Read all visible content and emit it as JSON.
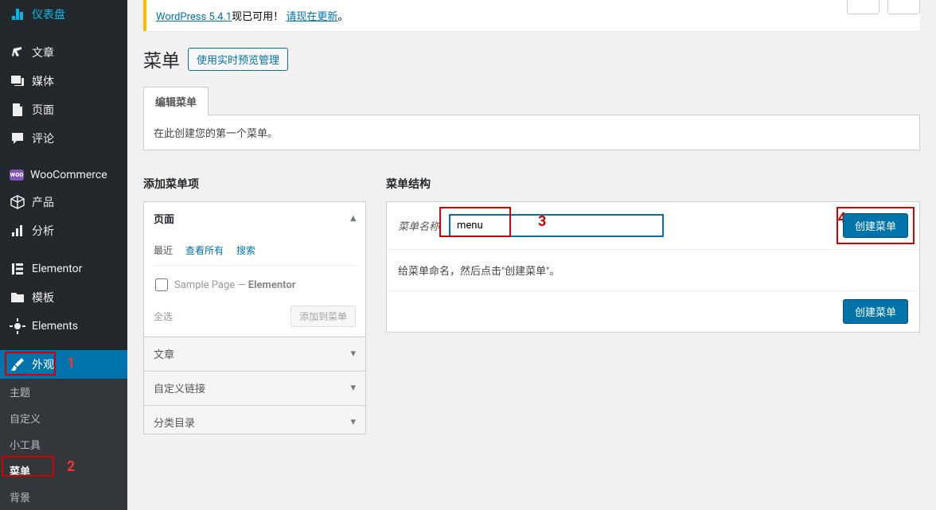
{
  "sidebar": {
    "dashboard": "仪表盘",
    "posts": "文章",
    "media": "媒体",
    "pages": "页面",
    "comments": "评论",
    "woocommerce": "WooCommerce",
    "products": "产品",
    "analytics": "分析",
    "elementor": "Elementor",
    "templates": "模板",
    "elements": "Elements",
    "appearance": "外观",
    "sub": {
      "themes": "主题",
      "customize": "自定义",
      "widgets": "小工具",
      "menus": "菜单",
      "background": "背景"
    }
  },
  "notice": {
    "prefix": "WordPress 5.4.1",
    "mid": "现已可用！",
    "link": "请现在更新",
    "suffix": "。"
  },
  "page_title": "菜单",
  "live_preview_btn": "使用实时预览管理",
  "tab_edit": "编辑菜单",
  "intro_text": "在此创建您的第一个菜单。",
  "add_items_title": "添加菜单项",
  "structure_title": "菜单结构",
  "acc": {
    "pages": "页面",
    "posts": "文章",
    "custom_links": "自定义链接",
    "categories": "分类目录"
  },
  "inner_tabs": {
    "recent": "最近",
    "view_all": "查看所有",
    "search": "搜索"
  },
  "sample_page": {
    "name": "Sample Page",
    "sep": " — ",
    "suffix": "Elementor"
  },
  "select_all": "全选",
  "add_to_menu": "添加到菜单",
  "menu_name_label": "菜单名称",
  "menu_name_value": "menu",
  "create_menu": "创建菜单",
  "instruction": "给菜单命名，然后点击\"创建菜单\"。",
  "annotation": {
    "n1": "1",
    "n2": "2",
    "n3": "3",
    "n4": "4"
  }
}
